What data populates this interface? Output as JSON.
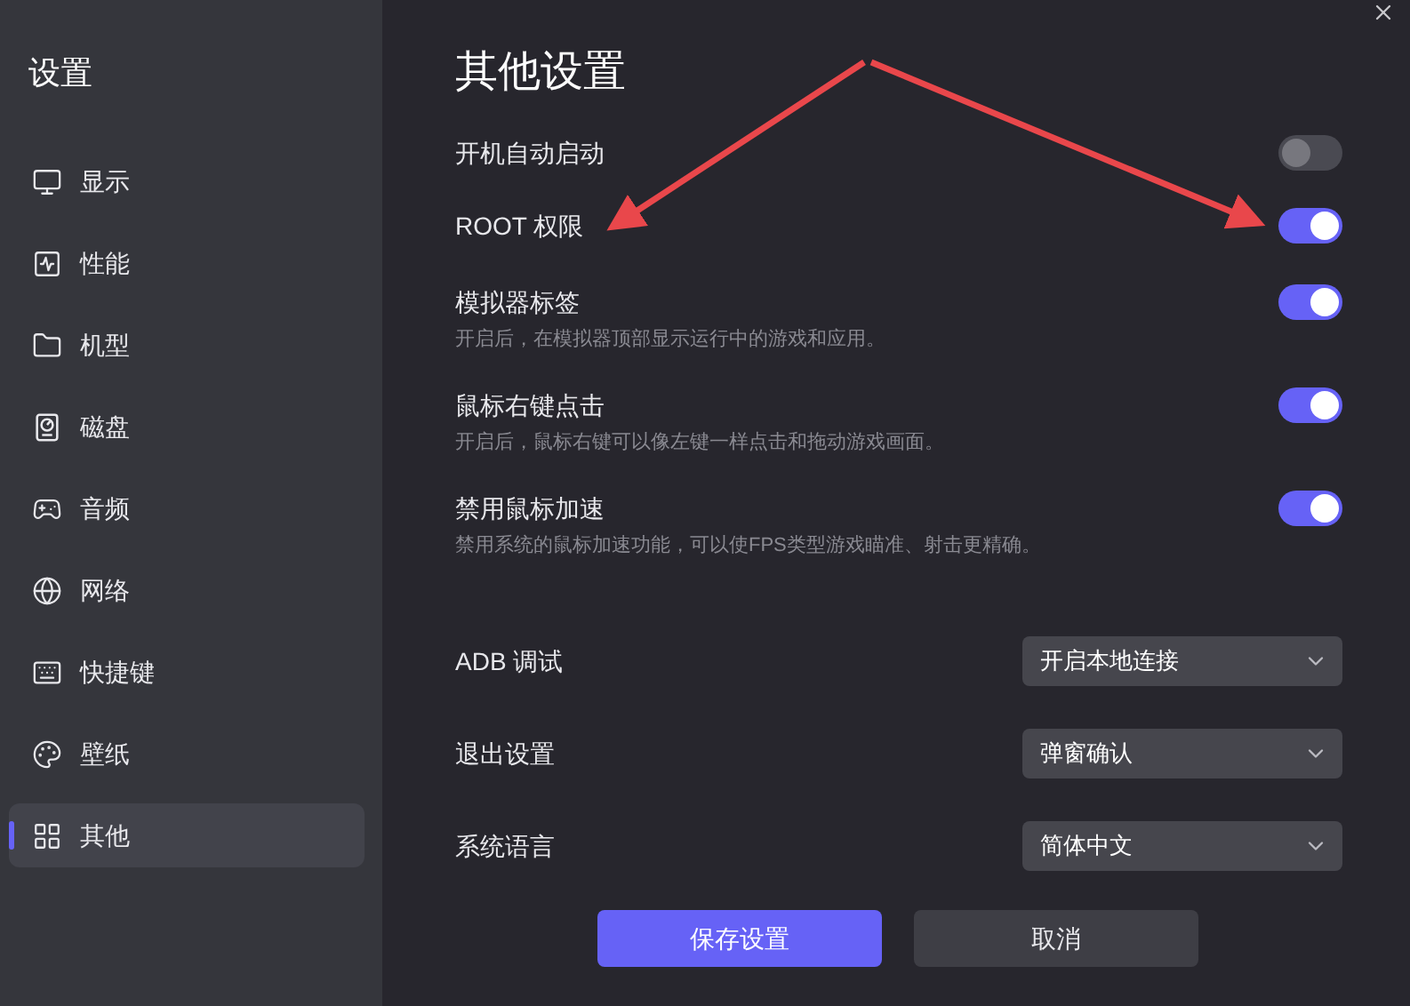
{
  "sidebar": {
    "title": "设置",
    "items": [
      {
        "label": "显示",
        "selected": false
      },
      {
        "label": "性能",
        "selected": false
      },
      {
        "label": "机型",
        "selected": false
      },
      {
        "label": "磁盘",
        "selected": false
      },
      {
        "label": "音频",
        "selected": false
      },
      {
        "label": "网络",
        "selected": false
      },
      {
        "label": "快捷键",
        "selected": false
      },
      {
        "label": "壁纸",
        "selected": false
      },
      {
        "label": "其他",
        "selected": true
      }
    ]
  },
  "page": {
    "title": "其他设置",
    "toggles": [
      {
        "label": "开机自动启动",
        "on": false
      },
      {
        "label": "ROOT 权限",
        "on": true
      },
      {
        "label": "模拟器标签",
        "description": "开启后，在模拟器顶部显示运行中的游戏和应用。",
        "on": true
      },
      {
        "label": "鼠标右键点击",
        "description": "开启后，鼠标右键可以像左键一样点击和拖动游戏画面。",
        "on": true
      },
      {
        "label": "禁用鼠标加速",
        "description": "禁用系统的鼠标加速功能，可以使FPS类型游戏瞄准、射击更精确。",
        "on": true
      }
    ],
    "selects": [
      {
        "label": "ADB 调试",
        "value": "开启本地连接"
      },
      {
        "label": "退出设置",
        "value": "弹窗确认"
      },
      {
        "label": "系统语言",
        "value": "简体中文"
      }
    ],
    "buttons": [
      {
        "label": "保存设置",
        "kind": "primary"
      },
      {
        "label": "取消",
        "kind": "secondary"
      }
    ]
  }
}
